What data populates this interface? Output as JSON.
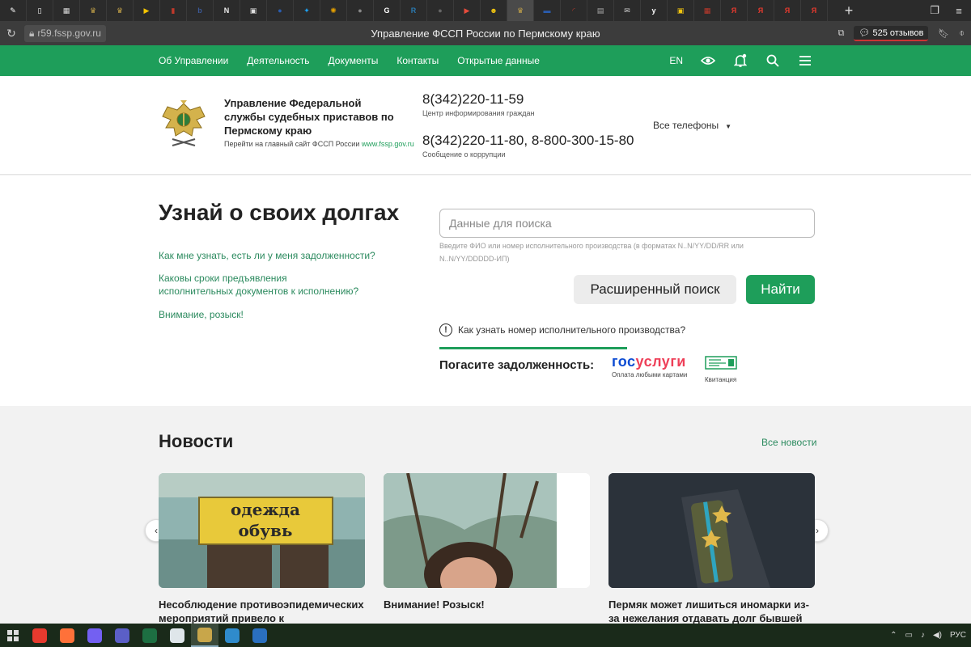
{
  "browser": {
    "tabs": [
      {
        "icon": "edit-icon",
        "color": "#ffffff",
        "glyph": "✎"
      },
      {
        "icon": "doc-icon",
        "color": "#ffffff",
        "glyph": "▯"
      },
      {
        "icon": "image-icon",
        "color": "#d9d9d9",
        "glyph": "▦"
      },
      {
        "icon": "emblem-icon",
        "color": "#c8a64a",
        "glyph": "♛"
      },
      {
        "icon": "emblem-icon",
        "color": "#c8a64a",
        "glyph": "♛"
      },
      {
        "icon": "play-icon",
        "color": "#f5c400",
        "glyph": "▶"
      },
      {
        "icon": "red-app-icon",
        "color": "#c0392b",
        "glyph": "▮"
      },
      {
        "icon": "b-icon",
        "color": "#3b5998",
        "glyph": "b"
      },
      {
        "icon": "news-icon",
        "color": "#eeeeee",
        "glyph": "N"
      },
      {
        "icon": "grid-icon",
        "color": "#dddddd",
        "glyph": "▣"
      },
      {
        "icon": "ru-flag-icon",
        "color": "#2a5db0",
        "glyph": "●"
      },
      {
        "icon": "twitter-icon",
        "color": "#1da1f2",
        "glyph": "✦"
      },
      {
        "icon": "sun-icon",
        "color": "#e6a100",
        "glyph": "✺"
      },
      {
        "icon": "gray-circle-icon",
        "color": "#888888",
        "glyph": "●"
      },
      {
        "icon": "g-icon",
        "color": "#ffffff",
        "glyph": "G"
      },
      {
        "icon": "r-icon",
        "color": "#2a7ab0",
        "glyph": "R"
      },
      {
        "icon": "gray-circle-icon",
        "color": "#666666",
        "glyph": "●"
      },
      {
        "icon": "play-red-icon",
        "color": "#e74c3c",
        "glyph": "▶"
      },
      {
        "icon": "yellow-face-icon",
        "color": "#f1c40f",
        "glyph": "☻"
      },
      {
        "icon": "emblem-icon",
        "color": "#c8a64a",
        "glyph": "♛"
      },
      {
        "icon": "ru-flag-icon",
        "color": "#2a5db0",
        "glyph": "▬"
      },
      {
        "icon": "red-hook-icon",
        "color": "#c0392b",
        "glyph": "◜"
      },
      {
        "icon": "strip-icon",
        "color": "#aaaaaa",
        "glyph": "▤"
      },
      {
        "icon": "mail-icon",
        "color": "#cccccc",
        "glyph": "✉"
      },
      {
        "icon": "y-close-icon",
        "color": "#ffffff",
        "glyph": "y"
      },
      {
        "icon": "yellow-doc-icon",
        "color": "#f1c40f",
        "glyph": "▣"
      },
      {
        "icon": "calendar-icon",
        "color": "#c0392b",
        "glyph": "▦"
      },
      {
        "icon": "yandex-icon",
        "color": "#e63a2e",
        "glyph": "Я"
      },
      {
        "icon": "yandex-icon",
        "color": "#e63a2e",
        "glyph": "Я"
      },
      {
        "icon": "yandex-icon",
        "color": "#e63a2e",
        "glyph": "Я"
      },
      {
        "icon": "yandex-icon",
        "color": "#e63a2e",
        "glyph": "Я"
      }
    ],
    "active_tab_index": 19,
    "url": "r59.fssp.gov.ru",
    "page_title": "Управление ФССП России по Пермскому краю",
    "reviews": "525 отзывов"
  },
  "nav": {
    "items": [
      "Об Управлении",
      "Деятельность",
      "Документы",
      "Контакты",
      "Открытые данные"
    ],
    "lang": "EN"
  },
  "header": {
    "org_name": "Управление Федеральной службы судебных приставов по Пермскому краю",
    "link_text": "Перейти на главный сайт ФССП России",
    "link_url": "www.fssp.gov.ru",
    "phone1": "8(342)220-11-59",
    "phone1_caption": "Центр информирования граждан",
    "phone2": "8(342)220-11-80, 8-800-300-15-80",
    "phone2_caption": "Сообщение о коррупции",
    "all_phones": "Все телефоны"
  },
  "debt": {
    "title": "Узнай о своих долгах",
    "links": [
      "Как мне узнать, есть ли у меня задолженности?",
      "Каковы сроки предъявления исполнительных документов к исполнению?",
      "Внимание, розыск!"
    ],
    "search_placeholder": "Данные для поиска",
    "hint": "Введите ФИО или номер исполнительного производства (в форматах N..N/YY/DD/RR или N..N/YY/DDDDD-ИП)",
    "advanced_button": "Расширенный поиск",
    "find_button": "Найти",
    "howto": "Как узнать номер исполнительного производства?",
    "pay_title": "Погасите задолженность:",
    "gosuslugi_a": "гос",
    "gosuslugi_b": "услуги",
    "gosuslugi_caption": "Оплата любыми картами",
    "receipt_caption": "Квитанция"
  },
  "news": {
    "title": "Новости",
    "all_link": "Все новости",
    "cards": [
      {
        "title": "Несоблюдение противоэпидемических мероприятий привело к",
        "sign_line1": "одежда",
        "sign_line2": "обувь"
      },
      {
        "title": "Внимание! Розыск!"
      },
      {
        "title": "Пермяк может лишиться иномарки из-за нежелания отдавать долг бывшей супруге"
      }
    ]
  },
  "taskbar": {
    "apps": [
      {
        "icon": "yandex-browser-icon",
        "color": "#e63a2e"
      },
      {
        "icon": "firefox-icon",
        "color": "#ff7139"
      },
      {
        "icon": "viber-icon",
        "color": "#7360f2"
      },
      {
        "icon": "teams-icon",
        "color": "#5b5fc7"
      },
      {
        "icon": "excel-icon",
        "color": "#1d6f42"
      },
      {
        "icon": "notepad-icon",
        "color": "#dfe6ea"
      },
      {
        "icon": "fssp-emblem-icon",
        "color": "#c8a64a"
      },
      {
        "icon": "photo-viewer-icon",
        "color": "#2f8bcc"
      },
      {
        "icon": "image-app-icon",
        "color": "#2a6fbf"
      }
    ],
    "active_app_index": 6,
    "lang": "РУС"
  }
}
